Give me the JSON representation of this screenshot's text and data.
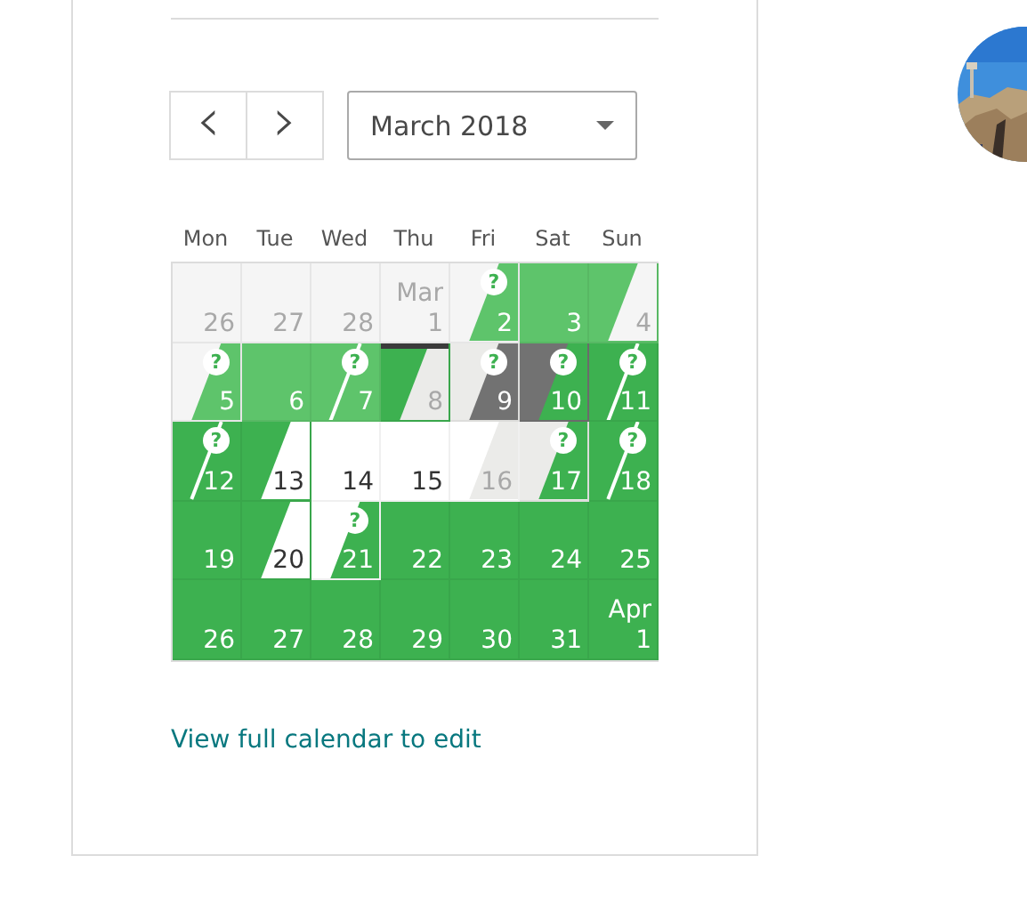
{
  "navigation": {
    "previous": "‹",
    "next": "›"
  },
  "month_select": {
    "value": "March 2018"
  },
  "weekdays": [
    "Mon",
    "Tue",
    "Wed",
    "Thu",
    "Fri",
    "Sat",
    "Sun"
  ],
  "note_glyph": "?",
  "weeks": [
    [
      {
        "day": "26",
        "color": "#f5f5f5"
      },
      {
        "day": "27",
        "color": "#f5f5f5"
      },
      {
        "day": "28",
        "color": "#f5f5f5"
      },
      {
        "month": "Mar",
        "day": "1",
        "color": "#f5f5f5"
      },
      {
        "day": "2",
        "halves": [
          {
            "color": "#f5f5f5"
          },
          {
            "color": "#5ec46b"
          }
        ],
        "note": true
      },
      {
        "day": "3",
        "color": "#5ec46b"
      },
      {
        "day": "4",
        "halves": [
          {
            "color": "#5ec46b"
          },
          {
            "color": "#f5f5f5"
          }
        ]
      }
    ],
    [
      {
        "day": "5",
        "halves": [
          {
            "color": "#f5f5f5"
          },
          {
            "color": "#5ec46b"
          }
        ],
        "note": true
      },
      {
        "day": "6",
        "color": "#5ec46b"
      },
      {
        "day": "7",
        "color": "#5ec46b",
        "slash": true,
        "note": true
      },
      {
        "day": "8",
        "halves": [
          {
            "color": "#3db150"
          },
          {
            "color": "#ebebe9"
          }
        ],
        "today": true
      },
      {
        "day": "9",
        "halves": [
          {
            "color": "#ebebe9"
          },
          {
            "color": "#727272"
          }
        ],
        "note": true
      },
      {
        "day": "10",
        "halves": [
          {
            "color": "#727272"
          },
          {
            "color": "#3db150"
          }
        ],
        "note": true
      },
      {
        "day": "11",
        "color": "#3db150",
        "slash": true,
        "note": true
      }
    ],
    [
      {
        "day": "12",
        "color": "#3db150",
        "slash": true,
        "note": true
      },
      {
        "day": "13",
        "halves": [
          {
            "color": "#3db150"
          },
          {
            "color": "#ffffff"
          }
        ]
      },
      {
        "day": "14",
        "color": "#ffffff"
      },
      {
        "day": "15",
        "color": "#ffffff"
      },
      {
        "day": "16",
        "halves": [
          {
            "color": "#ffffff"
          },
          {
            "color": "#ebebe9"
          }
        ]
      },
      {
        "day": "17",
        "halves": [
          {
            "color": "#ebebe9"
          },
          {
            "color": "#3db150"
          }
        ],
        "note": true
      },
      {
        "day": "18",
        "color": "#3db150",
        "slash": true,
        "note": true
      }
    ],
    [
      {
        "day": "19",
        "color": "#3db150"
      },
      {
        "day": "20",
        "halves": [
          {
            "color": "#3db150"
          },
          {
            "color": "#ffffff"
          }
        ]
      },
      {
        "day": "21",
        "halves": [
          {
            "color": "#ffffff"
          },
          {
            "color": "#3db150"
          }
        ],
        "note": true
      },
      {
        "day": "22",
        "color": "#3db150"
      },
      {
        "day": "23",
        "color": "#3db150"
      },
      {
        "day": "24",
        "color": "#3db150"
      },
      {
        "day": "25",
        "color": "#3db150"
      }
    ],
    [
      {
        "day": "26",
        "color": "#3db150"
      },
      {
        "day": "27",
        "color": "#3db150"
      },
      {
        "day": "28",
        "color": "#3db150"
      },
      {
        "day": "29",
        "color": "#3db150"
      },
      {
        "day": "30",
        "color": "#3db150"
      },
      {
        "day": "31",
        "color": "#3db150"
      },
      {
        "month": "Apr",
        "day": "1",
        "color": "#3db150"
      }
    ]
  ],
  "link": "View full calendar to edit"
}
